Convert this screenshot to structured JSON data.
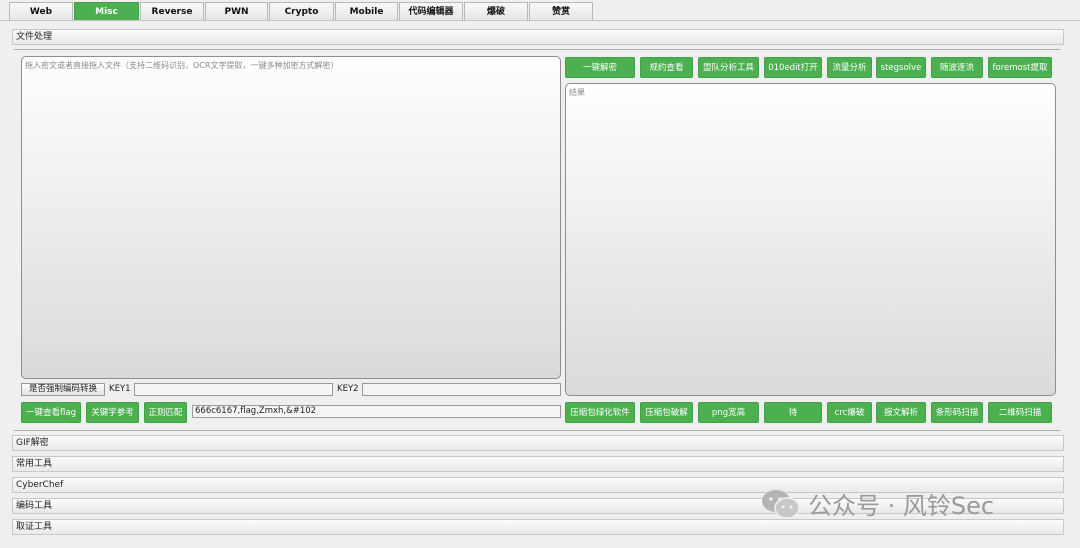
{
  "tabs": [
    "Web",
    "Misc",
    "Reverse",
    "PWN",
    "Crypto",
    "Mobile",
    "代码编辑器",
    "爆破",
    "赞赏"
  ],
  "sections": {
    "file_processing": "文件处理",
    "gif": "GIF解密",
    "common_tools": "常用工具",
    "cyberchef": "CyberChef",
    "encoding_tools": "编码工具",
    "forensics_tools": "取证工具"
  },
  "input": {
    "placeholder": "拖入密文或者直接拖入文件（支持二维码识别，OCR文字提取，一键多种加密方式解密）"
  },
  "result": {
    "placeholder": "结果"
  },
  "top_buttons": [
    "一键解密",
    "规约查看",
    "盟队分析工具",
    "010edit打开",
    "流量分析",
    "stegsolve",
    "随波逐流",
    "foremost提取"
  ],
  "options": {
    "force_encoding_label": "是否强制编码转换",
    "key1_label": "KEY1",
    "key1_value": "",
    "key2_label": "KEY2",
    "key2_value": ""
  },
  "bottom_left": {
    "view_flag": "一键查看flag",
    "keyword_ref": "关键字参考",
    "regex_match": "正则匹配",
    "regex_value": "666c6167,flag,Zmxh,&#102"
  },
  "bottom_buttons": [
    "压缩包绿化软件",
    "压缩包破解",
    "png宽高",
    "待",
    "crc爆破",
    "报文解析",
    "条形码扫描",
    "二维码扫描"
  ],
  "watermark": "公众号 · 风铃Sec",
  "colors": {
    "accent_green": "#4caf50",
    "panel_border": "#8e8e8e"
  }
}
